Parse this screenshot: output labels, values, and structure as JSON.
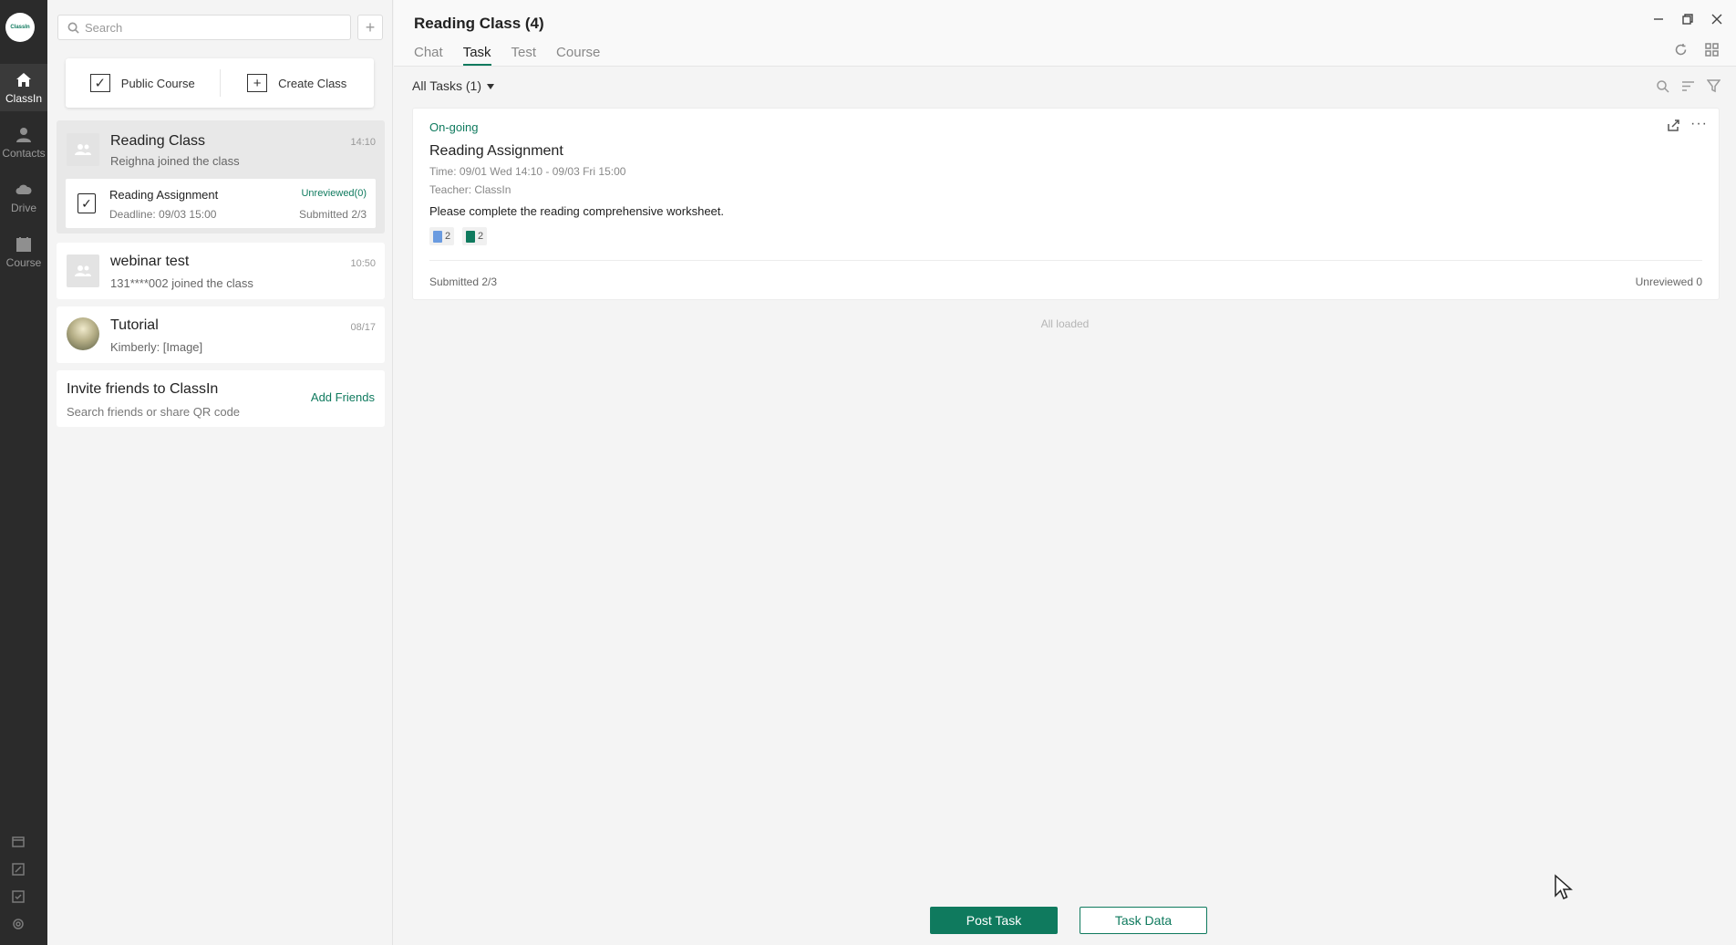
{
  "app": {
    "logo_text": "ClassIn"
  },
  "rail": {
    "items": [
      {
        "label": "ClassIn",
        "icon": "home-icon"
      },
      {
        "label": "Contacts",
        "icon": "person-icon"
      },
      {
        "label": "Drive",
        "icon": "cloud-icon"
      },
      {
        "label": "Course",
        "icon": "calendar-icon"
      }
    ]
  },
  "list": {
    "search_placeholder": "Search",
    "quick": {
      "public_course": "Public Course",
      "create_class": "Create Class"
    },
    "reading_class": {
      "title": "Reading Class",
      "sub": "Reighna joined the class",
      "time": "14:10",
      "task": {
        "title": "Reading Assignment",
        "deadline": "Deadline: 09/03 15:00",
        "unreviewed": "Unreviewed(0)",
        "submitted": "Submitted 2/3"
      }
    },
    "webinar": {
      "title": "webinar test",
      "sub": "131****002 joined the class",
      "time": "10:50"
    },
    "tutorial": {
      "title": "Tutorial",
      "sub": "Kimberly: [Image]",
      "time": "08/17"
    },
    "invite": {
      "title": "Invite friends to ClassIn",
      "sub": "Search friends or share QR code",
      "action": "Add Friends"
    }
  },
  "main": {
    "title": "Reading Class (4)",
    "tabs": [
      "Chat",
      "Task",
      "Test",
      "Course"
    ],
    "filter": "All Tasks (1)",
    "task": {
      "status": "On-going",
      "title": "Reading Assignment",
      "time": "Time: 09/01 Wed 14:10 - 09/03 Fri 15:00",
      "teacher": "Teacher: ClassIn",
      "description": "Please complete the reading comprehensive worksheet.",
      "attachments": [
        {
          "count": "2",
          "color": "#6a9be0"
        },
        {
          "count": "2",
          "color": "#0f7a5e"
        }
      ],
      "submitted": "Submitted 2/3",
      "unreviewed": "Unreviewed 0"
    },
    "all_loaded": "All loaded",
    "post_task": "Post Task",
    "task_data": "Task Data"
  },
  "colors": {
    "accent": "#0f7a5e",
    "rail_bg": "#2b2b2b"
  }
}
